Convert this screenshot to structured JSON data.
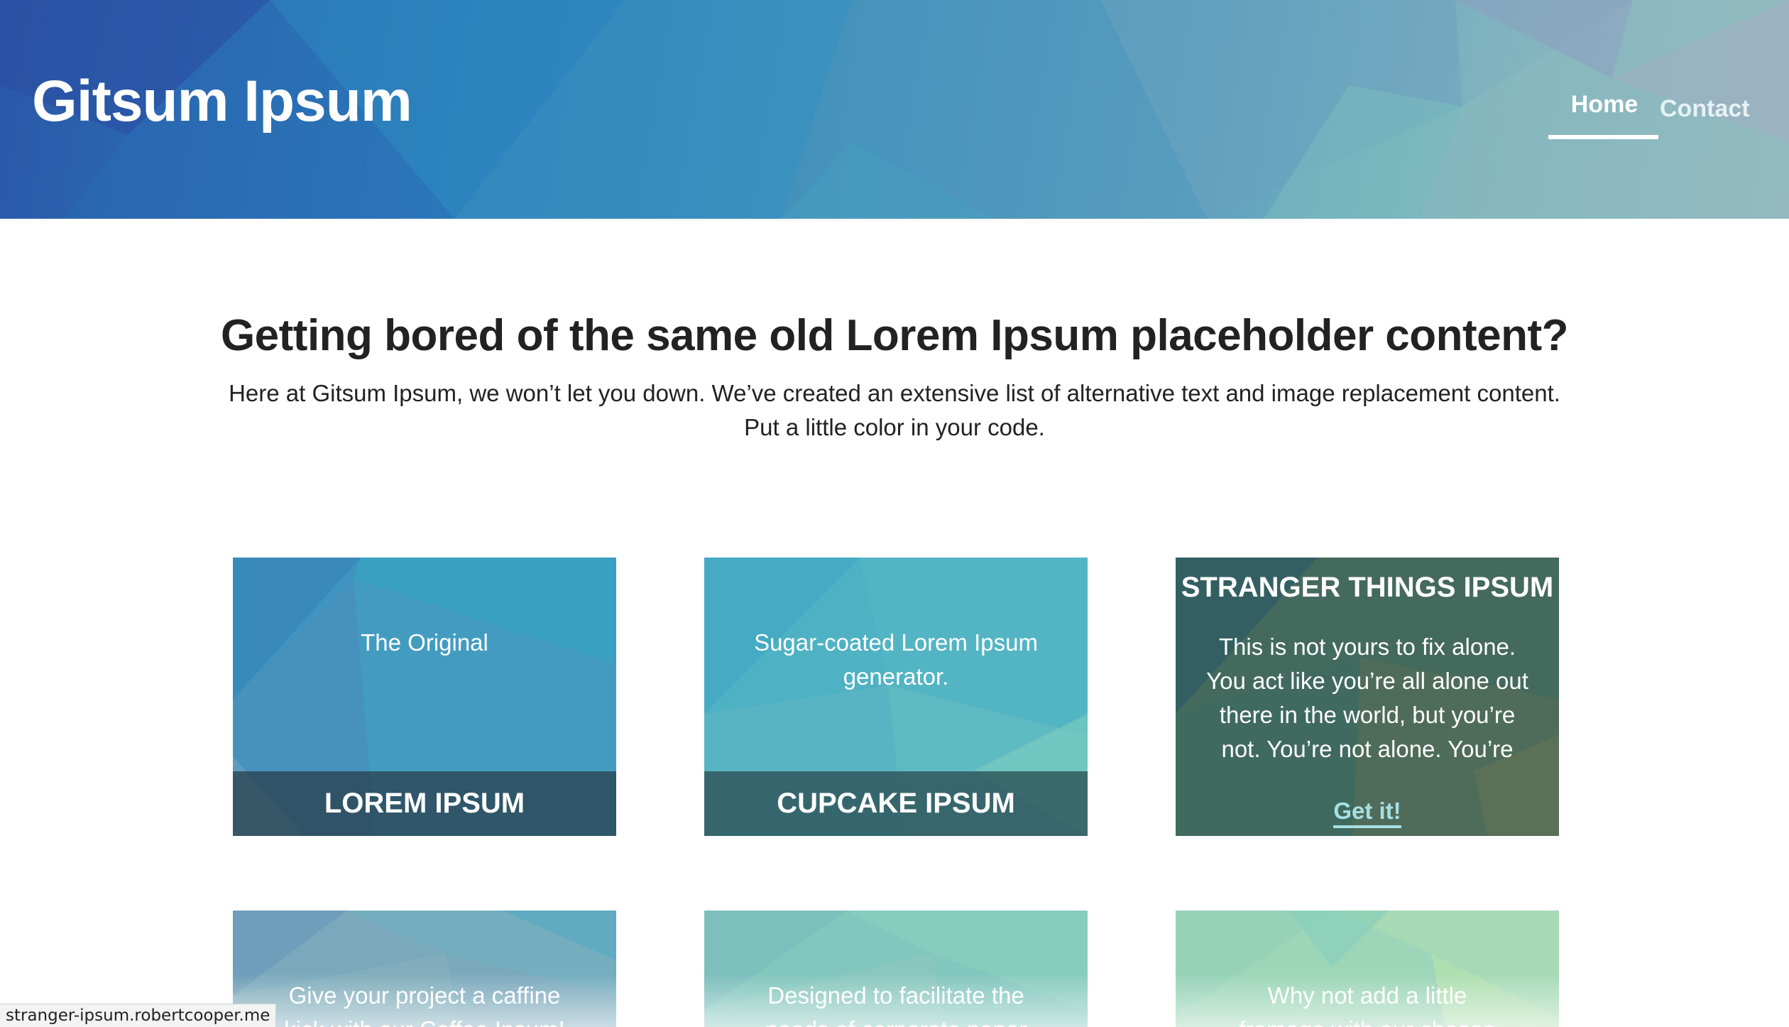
{
  "header": {
    "site_title": "Gitsum Ipsum",
    "nav": [
      {
        "label": "Home",
        "active": true
      },
      {
        "label": "Contact",
        "active": false
      }
    ]
  },
  "intro": {
    "title": "Getting bored of the same old Lorem Ipsum placeholder content?",
    "text_line1": "Here at Gitsum Ipsum, we won’t let you down. We’ve created an extensive list of alternative text and image replacement content.",
    "text_line2": "Put a little color in your code."
  },
  "cards": [
    {
      "description": "The Original",
      "title": "LOREM IPSUM"
    },
    {
      "description_line1": "Sugar-coated Lorem Ipsum",
      "description_line2": "generator.",
      "title": "CUPCAKE IPSUM"
    },
    {
      "title": "STRANGER THINGS IPSUM",
      "description_lines": [
        "This is not yours to fix alone.",
        "You act like you’re all alone out",
        "there in the world, but you’re",
        "not. You’re not alone. You’re"
      ],
      "link_label": "Get it!"
    },
    {
      "description_line1": "Give your project a caffine",
      "description_line2": "kick with our Coffee Ipsum!"
    },
    {
      "description_line1": "Designed to facilitate the",
      "description_line2": "needs of corporate paper"
    },
    {
      "description_line1": "Why not add a little",
      "description_line2": "fromage with our cheese"
    }
  ],
  "status_bar": {
    "url": "stranger-ipsum.robertcooper.me"
  },
  "colors": {
    "header_start": "#2b57a8",
    "header_end": "#9cb8c0",
    "card_lorem": "#3d95c0",
    "card_cupcake": "#4fb2c4",
    "card_stranger": "#3f6a60",
    "link_color": "#a8dfe3"
  }
}
